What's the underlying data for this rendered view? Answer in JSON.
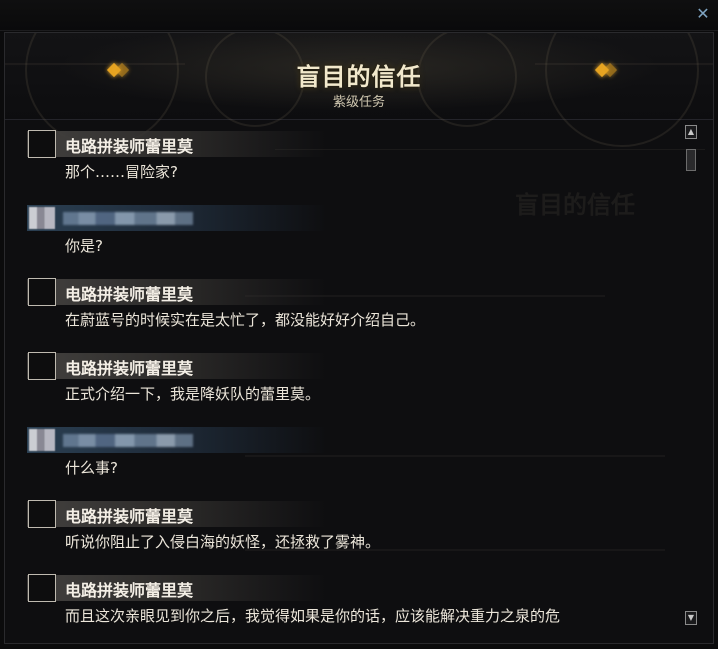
{
  "window": {
    "close_label": "✕"
  },
  "quest": {
    "title": "盲目的信任",
    "subtitle": "紫级任务"
  },
  "dialog": [
    {
      "speaker_type": "npc",
      "speaker": "电路拼装师蕾里莫",
      "text": "那个……冒险家?"
    },
    {
      "speaker_type": "player",
      "speaker": "",
      "text": "你是?"
    },
    {
      "speaker_type": "npc",
      "speaker": "电路拼装师蕾里莫",
      "text": "在蔚蓝号的时候实在是太忙了，都没能好好介绍自己。"
    },
    {
      "speaker_type": "npc",
      "speaker": "电路拼装师蕾里莫",
      "text": "正式介绍一下，我是降妖队的蕾里莫。"
    },
    {
      "speaker_type": "player",
      "speaker": "",
      "text": "什么事?"
    },
    {
      "speaker_type": "npc",
      "speaker": "电路拼装师蕾里莫",
      "text": "听说你阻止了入侵白海的妖怪，还拯救了雾神。"
    },
    {
      "speaker_type": "npc",
      "speaker": "电路拼装师蕾里莫",
      "text": "而且这次亲眼见到你之后，我觉得如果是你的话，应该能解决重力之泉的危"
    }
  ],
  "scrollbar": {
    "up": "▲",
    "down": "▼"
  },
  "colors": {
    "accent": "#e6a321",
    "title": "#f2e9cc"
  }
}
